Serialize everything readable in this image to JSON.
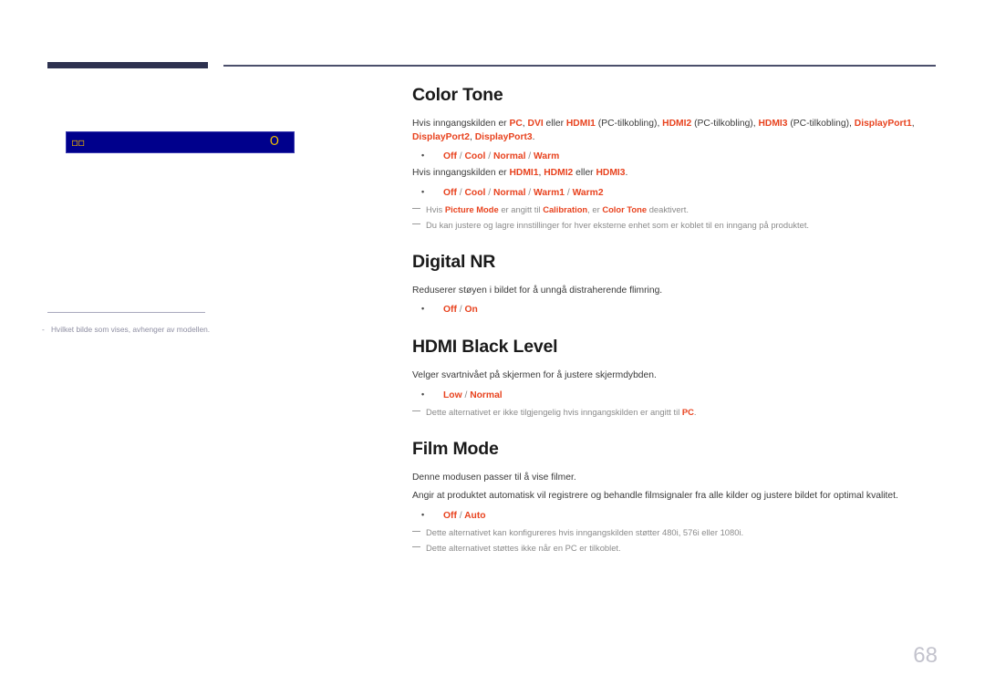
{
  "document": {
    "page_number": "68"
  },
  "left_panel": {
    "osd": {
      "left_glyph": "icon",
      "right_glyph": "O"
    },
    "footnote": {
      "dash": "-",
      "text": "Hvilket bilde som vises, avhenger av modellen."
    }
  },
  "sections": [
    {
      "id": "color-tone",
      "title": "Color Tone",
      "paragraph1_parts": [
        {
          "t": "Hvis inngangskilden er ",
          "kw": false
        },
        {
          "t": "PC",
          "kw": true
        },
        {
          "t": ", ",
          "kw": false
        },
        {
          "t": "DVI",
          "kw": true
        },
        {
          "t": " eller ",
          "kw": false
        },
        {
          "t": "HDMI1",
          "kw": true
        },
        {
          "t": " (PC-tilkobling), ",
          "kw": false
        },
        {
          "t": "HDMI2",
          "kw": true
        },
        {
          "t": " (PC-tilkobling), ",
          "kw": false
        },
        {
          "t": "HDMI3",
          "kw": true
        },
        {
          "t": " (PC-tilkobling), ",
          "kw": false
        },
        {
          "t": "DisplayPort1",
          "kw": true
        },
        {
          "t": ", ",
          "kw": false
        },
        {
          "t": "DisplayPort2",
          "kw": true
        },
        {
          "t": ", ",
          "kw": false
        },
        {
          "t": "DisplayPort3",
          "kw": true
        },
        {
          "t": ".",
          "kw": false
        }
      ],
      "option1": "Off / Cool / Normal / Warm",
      "paragraph2_parts": [
        {
          "t": "Hvis inngangskilden er ",
          "kw": false
        },
        {
          "t": "HDMI1",
          "kw": true
        },
        {
          "t": ", ",
          "kw": false
        },
        {
          "t": "HDMI2",
          "kw": true
        },
        {
          "t": " eller ",
          "kw": false
        },
        {
          "t": "HDMI3",
          "kw": true
        },
        {
          "t": ".",
          "kw": false
        }
      ],
      "option2": "Off / Cool / Normal / Warm1 / Warm2",
      "note1_parts": [
        {
          "t": "Hvis ",
          "kw": false
        },
        {
          "t": "Picture Mode",
          "kw": true
        },
        {
          "t": " er angitt til ",
          "kw": false
        },
        {
          "t": "Calibration",
          "kw": true
        },
        {
          "t": ", er ",
          "kw": false
        },
        {
          "t": "Color Tone",
          "kw": true
        },
        {
          "t": " deaktivert.",
          "kw": false
        }
      ],
      "note2_parts": [
        {
          "t": "Du kan justere og lagre innstillinger for hver eksterne enhet som er koblet til en inngang på produktet.",
          "kw": false
        }
      ]
    },
    {
      "id": "digital-nr",
      "title": "Digital NR",
      "paragraph1_parts": [
        {
          "t": "Reduserer støyen i bildet for å unngå distraherende flimring.",
          "kw": false
        }
      ],
      "option1": "Off / On"
    },
    {
      "id": "hdmi-black-level",
      "title": "HDMI Black Level",
      "paragraph1_parts": [
        {
          "t": "Velger svartnivået på skjermen for å justere skjermdybden.",
          "kw": false
        }
      ],
      "option1": "Low / Normal",
      "note1_parts": [
        {
          "t": "Dette alternativet er ikke tilgjengelig hvis inngangskilden er angitt til ",
          "kw": false
        },
        {
          "t": "PC",
          "kw": true
        },
        {
          "t": ".",
          "kw": false
        }
      ]
    },
    {
      "id": "film-mode",
      "title": "Film Mode",
      "paragraph1_parts": [
        {
          "t": "Denne modusen passer til å vise filmer.",
          "kw": false
        }
      ],
      "paragraph2_parts": [
        {
          "t": "Angir at produktet automatisk vil registrere og behandle filmsignaler fra alle kilder og justere bildet for optimal kvalitet.",
          "kw": false
        }
      ],
      "option1": "Off / Auto",
      "note1_parts": [
        {
          "t": "Dette alternativet kan konfigureres hvis inngangskilden støtter 480i, 576i eller 1080i.",
          "kw": false
        }
      ],
      "note2_parts": [
        {
          "t": "Dette alternativet støttes ikke når en PC er tilkoblet.",
          "kw": false
        }
      ]
    }
  ],
  "colors": {
    "keyword_red": "#e8431f",
    "header_navy": "#2e3250",
    "osd_blue": "#00008c",
    "osd_yellow": "#f0c000",
    "note_gray": "#8b8b8b",
    "page_number_gray": "#c3c3cd"
  }
}
